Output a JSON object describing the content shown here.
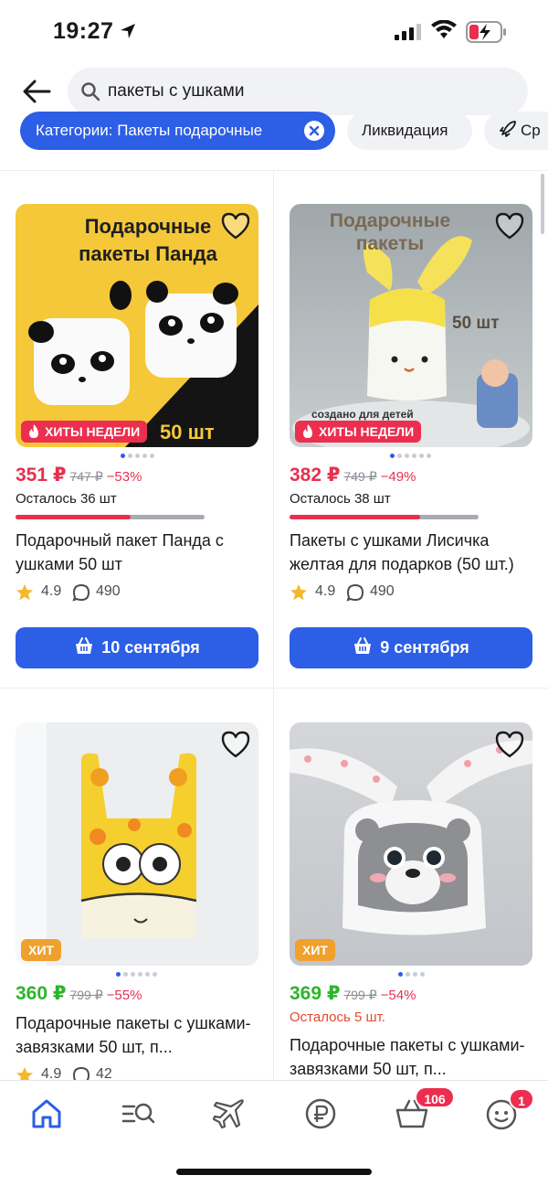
{
  "status": {
    "time": "19:27"
  },
  "search": {
    "query": "пакеты с ушками"
  },
  "chips": [
    {
      "label": "Категории: Пакеты подарочные"
    },
    {
      "label": "Ликвидация"
    },
    {
      "label": "Ср"
    }
  ],
  "products": [
    {
      "image_title": "Подарочные пакеты Панда",
      "image_count": "50 шт",
      "badge": "ХИТЫ НЕДЕЛИ",
      "price": "351 ₽",
      "old_price": "747 ₽",
      "discount": "−53%",
      "left": "Осталось 36 шт",
      "stock_fraction": 0.61,
      "title": "Подарочный пакет Панда с ушками 50 шт",
      "rating": "4.9",
      "reviews": "490",
      "delivery": "10 сентября"
    },
    {
      "image_title": "Подарочные пакеты",
      "image_count": "50 шт",
      "image_caption": "создано для детей",
      "badge": "ХИТЫ НЕДЕЛИ",
      "price": "382 ₽",
      "old_price": "749 ₽",
      "discount": "−49%",
      "left": "Осталось 38 шт",
      "stock_fraction": 0.69,
      "title": "Пакеты с ушками Лисичка желтая для подарков (50 шт.)",
      "rating": "4.9",
      "reviews": "490",
      "delivery": "9 сентября"
    },
    {
      "badge": "ХИТ",
      "price": "360 ₽",
      "old_price": "799 ₽",
      "discount": "−55%",
      "title": "Подарочные пакеты с ушками-завязками 50 шт, п...",
      "rating": "4.9",
      "reviews": "42"
    },
    {
      "badge": "ХИТ",
      "price": "369 ₽",
      "old_price": "799 ₽",
      "discount": "−54%",
      "left": "Осталось 5 шт.",
      "title": "Подарочные пакеты с ушками-завязками 50 шт, п..."
    }
  ],
  "tabbar": {
    "cart_badge": "106",
    "profile_badge": "1"
  },
  "colors": {
    "accent": "#2c5ee6",
    "sale_red": "#e8304e",
    "green_price": "#2cb52c",
    "hit_orange": "#f0a02c"
  }
}
